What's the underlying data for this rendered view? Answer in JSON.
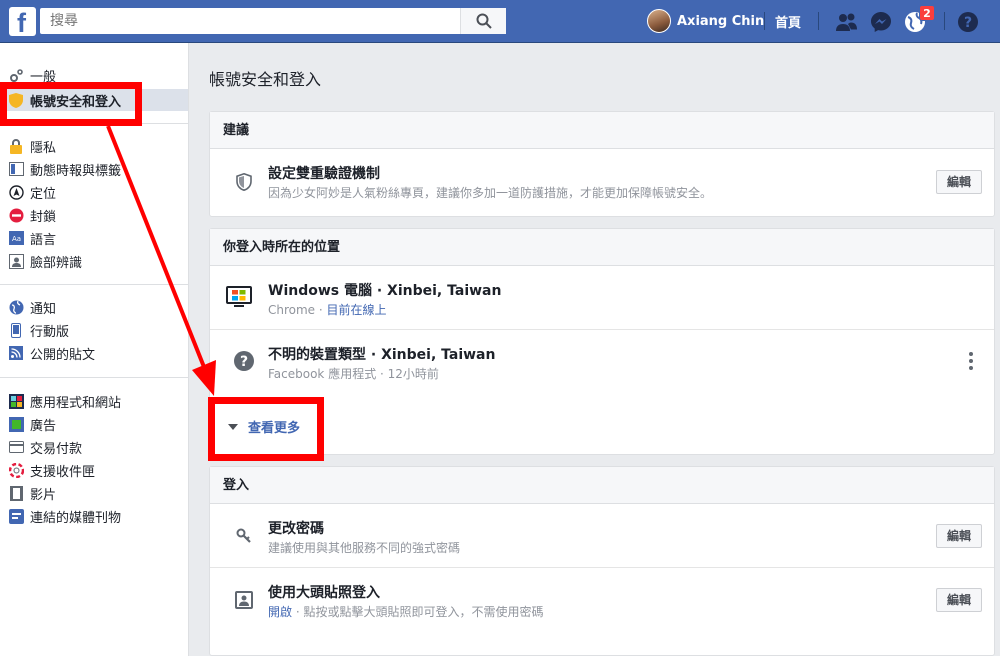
{
  "topbar": {
    "search_placeholder": "搜尋",
    "user_name": "Axiang Chin",
    "home_label": "首頁",
    "notification_count": "2"
  },
  "sidebar": {
    "items": [
      {
        "label": "一般",
        "icon": "gear-icon"
      },
      {
        "label": "帳號安全和登入",
        "icon": "shield-icon",
        "selected": true
      },
      {
        "label": "隱私",
        "icon": "lock-icon"
      },
      {
        "label": "動態時報與標籤",
        "icon": "timeline-icon"
      },
      {
        "label": "定位",
        "icon": "location-icon"
      },
      {
        "label": "封鎖",
        "icon": "block-icon"
      },
      {
        "label": "語言",
        "icon": "language-icon"
      },
      {
        "label": "臉部辨識",
        "icon": "face-recognition-icon"
      },
      {
        "label": "通知",
        "icon": "globe-icon"
      },
      {
        "label": "行動版",
        "icon": "mobile-icon"
      },
      {
        "label": "公開的貼文",
        "icon": "rss-icon"
      },
      {
        "label": "應用程式和網站",
        "icon": "apps-icon"
      },
      {
        "label": "廣告",
        "icon": "ads-icon"
      },
      {
        "label": "交易付款",
        "icon": "payment-icon"
      },
      {
        "label": "支援收件匣",
        "icon": "support-icon"
      },
      {
        "label": "影片",
        "icon": "video-icon"
      },
      {
        "label": "連結的媒體刊物",
        "icon": "media-icon"
      }
    ]
  },
  "main": {
    "page_title": "帳號安全和登入",
    "suggestions": {
      "header": "建議",
      "two_factor": {
        "title": "設定雙重驗證機制",
        "subtitle": "因為少女阿妙是人氣粉絲專頁，建議你多加一道防護措施，才能更加保障帳號安全。",
        "button": "編輯"
      }
    },
    "where_logged_in": {
      "header": "你登入時所在的位置",
      "sessions": [
        {
          "title": "Windows 電腦 · Xinbei, Taiwan",
          "app": "Chrome",
          "separator": " · ",
          "status": "目前在線上"
        },
        {
          "title": "不明的裝置類型 · Xinbei, Taiwan",
          "app": "Facebook 應用程式",
          "separator": " · ",
          "status": "12小時前"
        }
      ],
      "see_more": "查看更多"
    },
    "login": {
      "header": "登入",
      "change_password": {
        "title": "更改密碼",
        "subtitle": "建議使用與其他服務不同的強式密碼",
        "button": "編輯"
      },
      "profile_picture_login": {
        "title": "使用大頭貼照登入",
        "status": "開啟",
        "subtitle": " · 點按或點擊大頭貼照即可登入，不需使用密碼",
        "button": "編輯"
      }
    }
  },
  "colors": {
    "facebook_blue": "#4267b2",
    "annotation_red": "#ff0000"
  }
}
